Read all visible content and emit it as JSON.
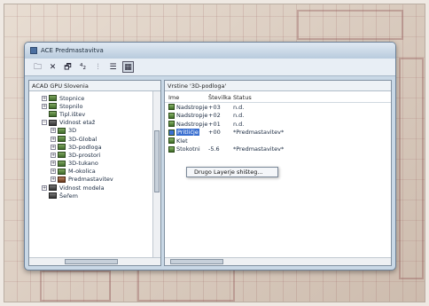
{
  "window": {
    "title": "ACE Predmastavitva"
  },
  "toolbar": {
    "buttons": [
      {
        "icon": "folder-icon",
        "glyph": "🗀"
      },
      {
        "icon": "close-icon",
        "glyph": "✕"
      },
      {
        "icon": "properties-icon",
        "glyph": "🗗"
      },
      {
        "icon": "sort-icon",
        "glyph": "⁴₂"
      },
      {
        "icon": "filter-icon",
        "glyph": "⫶"
      },
      {
        "icon": "list-view-icon",
        "glyph": "☰"
      },
      {
        "icon": "detail-view-icon",
        "glyph": "▦"
      }
    ]
  },
  "left_pane": {
    "header": "ACAD GPU Slovenia",
    "tree": [
      {
        "label": "Stopnice",
        "level": 1,
        "expander": "+",
        "icon": "green"
      },
      {
        "label": "Stopnilo",
        "level": 1,
        "expander": "+",
        "icon": "green"
      },
      {
        "label": "Tipl.ištev",
        "level": 1,
        "expander": "",
        "icon": "green"
      },
      {
        "label": "Vidnost etaž",
        "level": 1,
        "expander": "−",
        "icon": "dark"
      },
      {
        "label": "3D",
        "level": 2,
        "expander": "+",
        "icon": "green"
      },
      {
        "label": "3D-Global",
        "level": 2,
        "expander": "+",
        "icon": "green"
      },
      {
        "label": "3D-podloga",
        "level": 2,
        "expander": "+",
        "icon": "green"
      },
      {
        "label": "3D-prostori",
        "level": 2,
        "expander": "+",
        "icon": "green"
      },
      {
        "label": "3D-tukano",
        "level": 2,
        "expander": "+",
        "icon": "green"
      },
      {
        "label": "M-okolica",
        "level": 2,
        "expander": "+",
        "icon": "green"
      },
      {
        "label": "Predmastavitev",
        "level": 2,
        "expander": "+",
        "icon": "rust"
      },
      {
        "label": "Vidnost modela",
        "level": 1,
        "expander": "+",
        "icon": "dark"
      },
      {
        "label": "Šeřem",
        "level": 1,
        "expander": "",
        "icon": "dark"
      }
    ]
  },
  "right_pane": {
    "header": "Vrstine '3D-podloga'",
    "columns": [
      "Ime",
      "Številka",
      "Status"
    ],
    "rows": [
      {
        "name": "Nadstropje",
        "number": "+03",
        "status": "n.d."
      },
      {
        "name": "Nadstropje",
        "number": "+02",
        "status": "n.d."
      },
      {
        "name": "Nadstropje",
        "number": "+01",
        "status": "n.d."
      },
      {
        "name": "Pritličje",
        "number": "+00",
        "status": "*Predmastavitev*"
      },
      {
        "name": "Klet",
        "number": "",
        "status": ""
      },
      {
        "name": "Stokotni",
        "number": "-5.6",
        "status": "*Predmastavitev*"
      }
    ]
  },
  "context_menu": {
    "item": "Drugo Layerje shišteg..."
  }
}
